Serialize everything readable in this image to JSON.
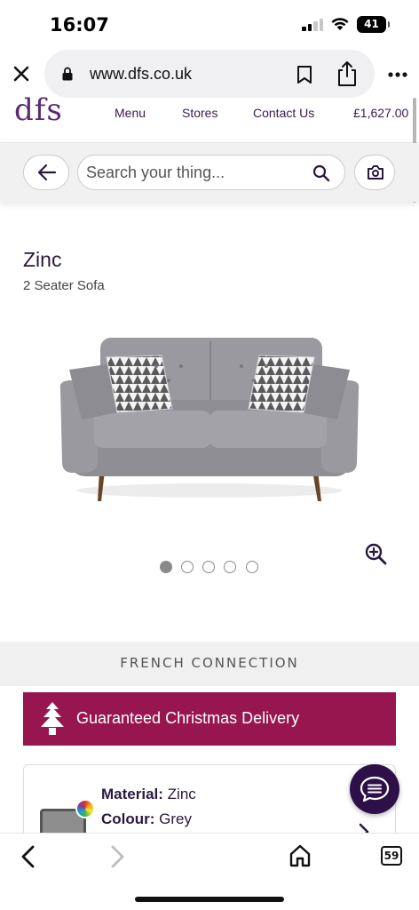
{
  "status_bar": {
    "time": "16:07",
    "battery": "41"
  },
  "browser": {
    "url": "www.dfs.co.uk"
  },
  "site_nav": {
    "logo": "dfs",
    "menu": "Menu",
    "stores": "Stores",
    "contact": "Contact Us",
    "basket_total": "£1,627.00"
  },
  "search": {
    "placeholder": "Search your thing..."
  },
  "product": {
    "title": "Zinc",
    "subtitle": "2 Seater Sofa",
    "image_count": 5,
    "active_image": 1
  },
  "brand": {
    "name": "FRENCH CONNECTION"
  },
  "delivery": {
    "text": "Guaranteed Christmas Delivery"
  },
  "options": {
    "material_label": "Material:",
    "material_value": "Zinc",
    "colour_label": "Colour:",
    "colour_value": "Grey"
  },
  "toolbar": {
    "tab_count": "59"
  },
  "colors": {
    "brand_purple": "#5c2a72",
    "banner_magenta": "#98164f",
    "chat_purple": "#2d1048"
  }
}
